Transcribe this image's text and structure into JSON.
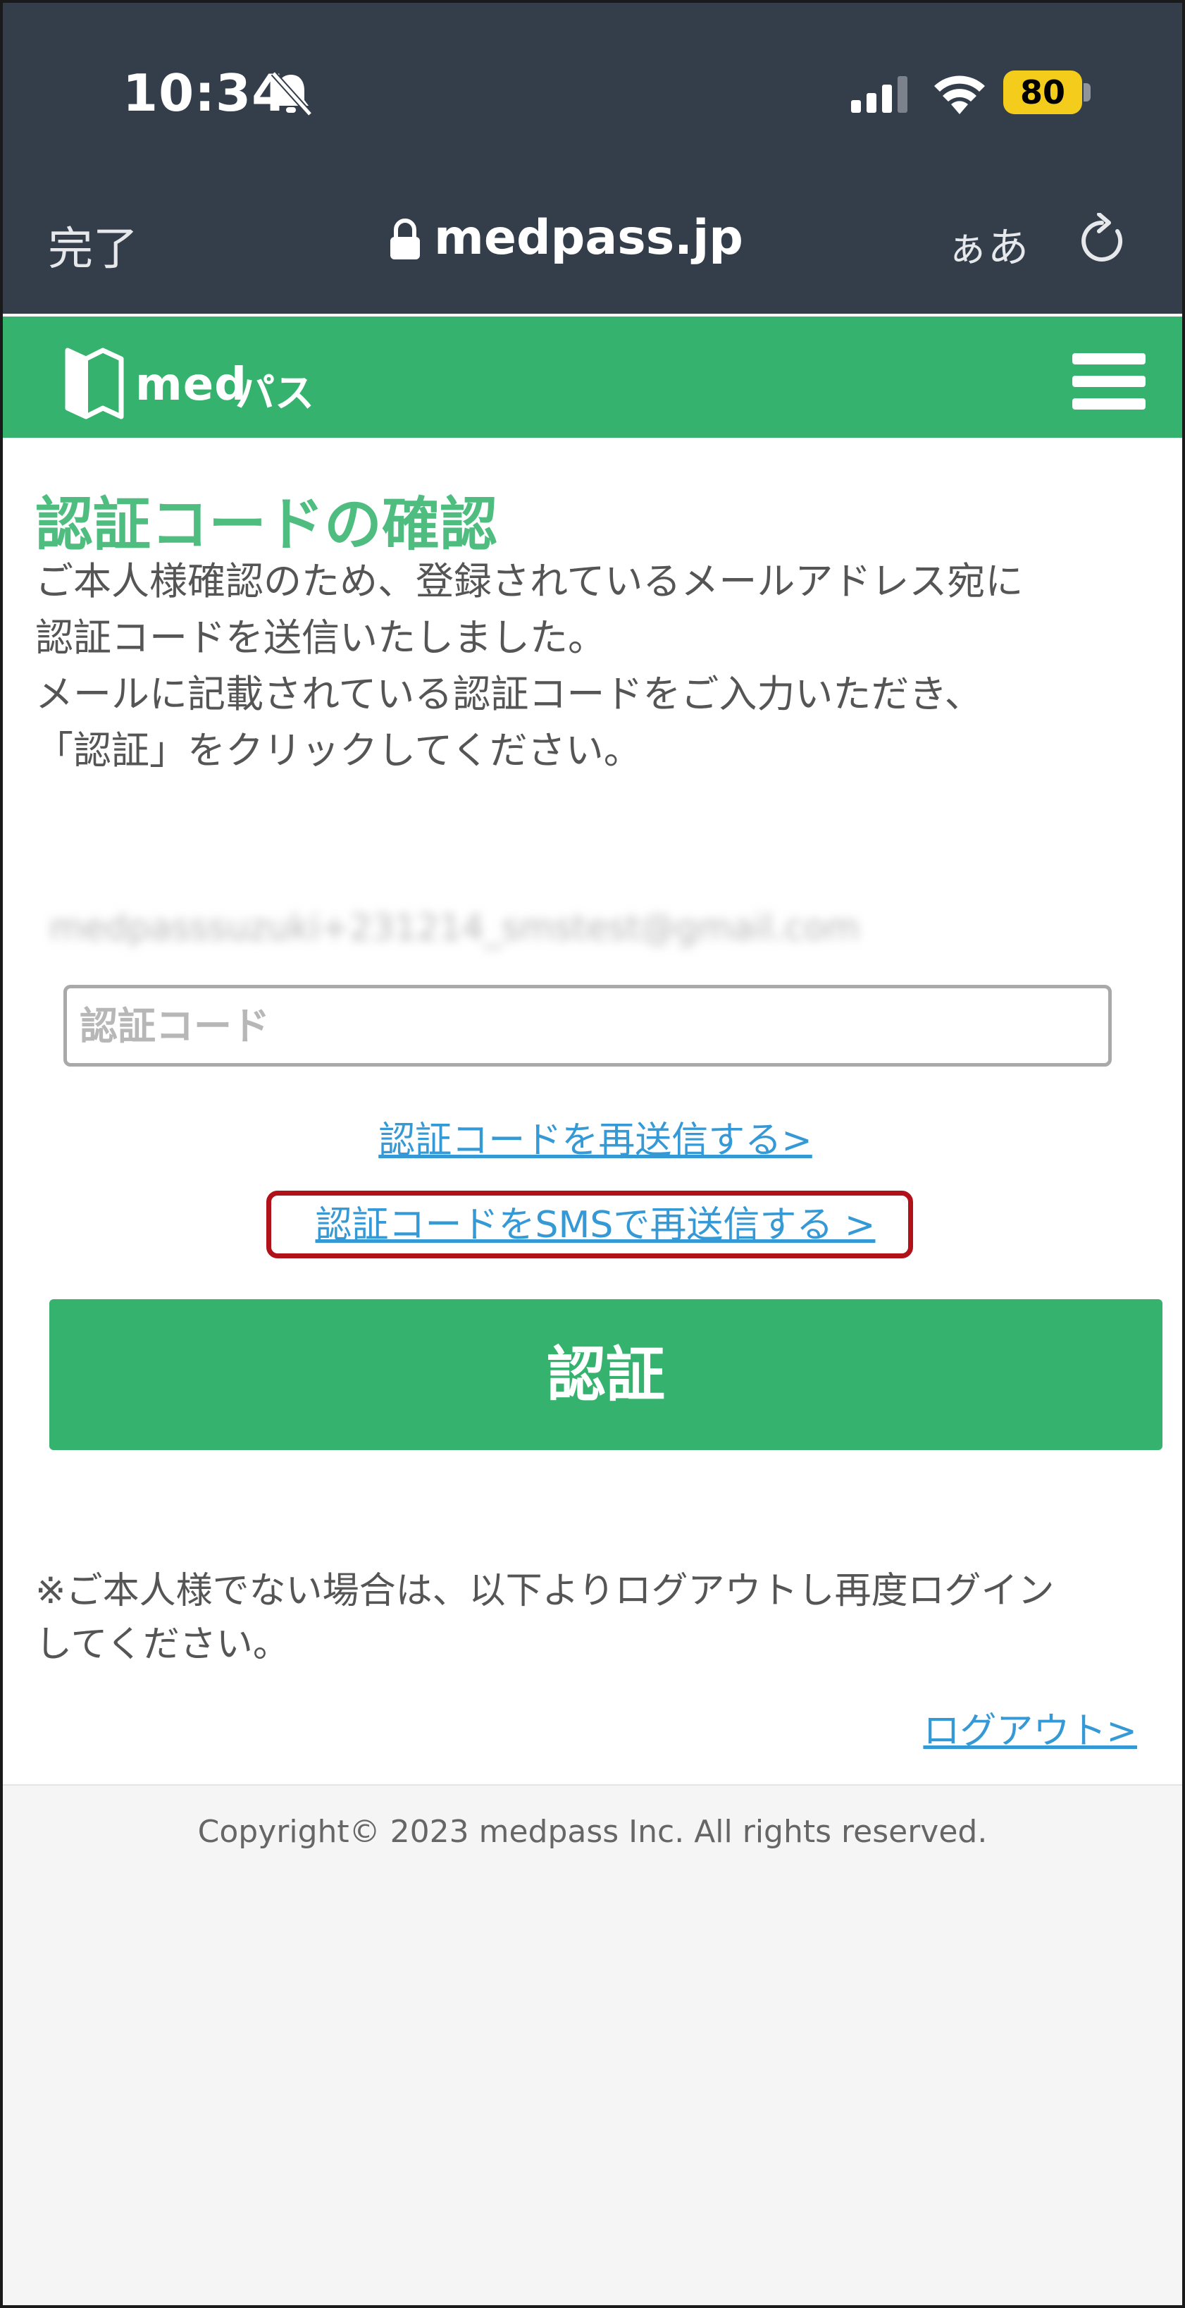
{
  "status_bar": {
    "time": "10:34",
    "battery": "80",
    "icons": [
      "bell-slash-icon",
      "signal-icon",
      "wifi-icon",
      "battery-icon"
    ]
  },
  "browser": {
    "done_label": "完了",
    "url": "medpass.jp",
    "text_size_label": "ぁあ",
    "icons": [
      "lock-icon",
      "reload-icon"
    ]
  },
  "header": {
    "logo_text": "med",
    "logo_kana": "パス",
    "icons": [
      "medpass-logo-icon",
      "hamburger-menu-icon"
    ]
  },
  "main": {
    "title": "認証コードの確認",
    "intro_lines": [
      "ご本人様確認のため、登録されているメールアドレス宛に",
      "認証コードを送信いたしました。",
      "メールに記載されている認証コードをご入力いただき、",
      "「認証」をクリックしてください。"
    ],
    "email": "medpasssuzuki+231214_smstest@gmail.com",
    "code_placeholder": "認証コード",
    "resend_link": "認証コードを再送信する>",
    "sms_resend_link": "認証コードをSMSで再送信する >",
    "auth_button": "認証",
    "notice_lines": [
      "※ご本人様でない場合は、以下よりログアウトし再度ログイン",
      "してください。"
    ],
    "logout_link": "ログアウト>"
  },
  "footer": {
    "copyright": "Copyright© 2023 medpass Inc. All rights reserved."
  },
  "colors": {
    "chrome": "#343e4b",
    "brand_green": "#35b36e",
    "title_green": "#4fbd80",
    "link_blue": "#3599d6",
    "highlight_red": "#b1121a"
  }
}
